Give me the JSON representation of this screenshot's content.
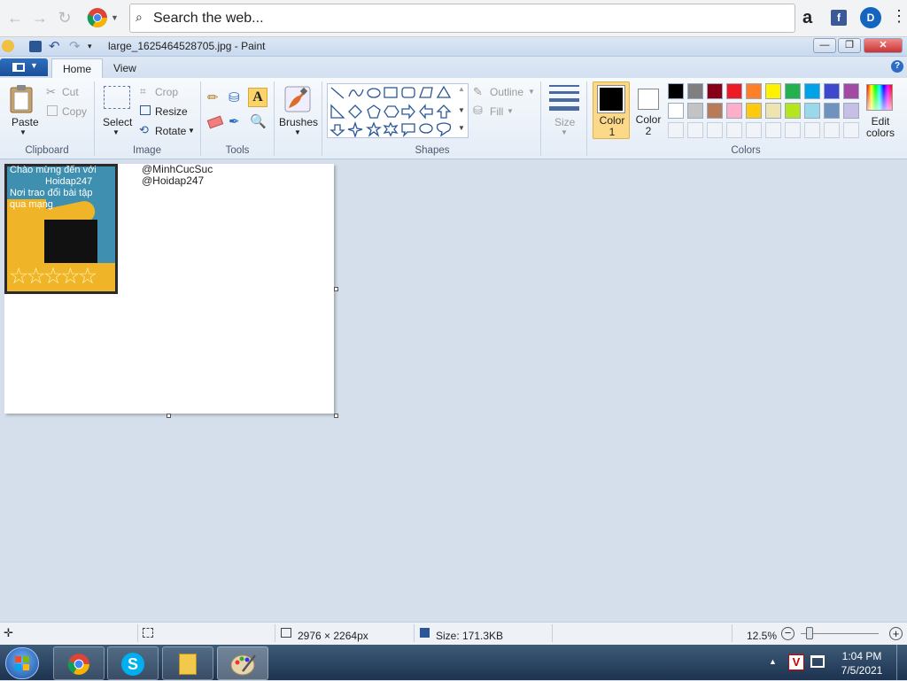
{
  "browser": {
    "search_placeholder": "Search the web...",
    "icons": [
      "back-icon",
      "forward-icon",
      "reload-icon",
      "chrome-icon",
      "search-icon",
      "amazon-icon",
      "facebook-icon",
      "d-icon",
      "more-icon"
    ]
  },
  "paint": {
    "window_title": "large_1625464528705.jpg - Paint",
    "tabs": [
      "Home",
      "View"
    ],
    "clipboard": {
      "paste": "Paste",
      "cut": "Cut",
      "copy": "Copy",
      "label": "Clipboard"
    },
    "image": {
      "select": "Select",
      "crop": "Crop",
      "resize": "Resize",
      "rotate": "Rotate",
      "label": "Image"
    },
    "tools": {
      "label": "Tools"
    },
    "brushes": "Brushes",
    "shapes": {
      "outline": "Outline",
      "fill": "Fill",
      "label": "Shapes"
    },
    "size": "Size",
    "colors": {
      "color1": "Color\n1",
      "color1_line1": "Color",
      "color1_line2": "1",
      "color2_line1": "Color",
      "color2_line2": "2",
      "edit_line1": "Edit",
      "edit_line2": "colors",
      "label": "Colors",
      "row1": [
        "#000000",
        "#7f7f7f",
        "#880015",
        "#ed1c24",
        "#ff7f27",
        "#fff200",
        "#22b14c",
        "#00a2e8",
        "#3f48cc",
        "#a349a4"
      ],
      "row2": [
        "#ffffff",
        "#c3c3c3",
        "#b97a57",
        "#ffaec9",
        "#ffc90e",
        "#efe4b0",
        "#b5e61d",
        "#99d9ea",
        "#7092be",
        "#c8bfe7"
      ]
    }
  },
  "canvas": {
    "thumb_text1": "Chào mừng đến với",
    "thumb_text2": "Hoidap247",
    "thumb_text3": "Nơi trao đổi bài tập",
    "thumb_text4": "qua mạng",
    "handle1": "@MinhCucSuc",
    "handle2": "@Hoidap247"
  },
  "status": {
    "dimensions": "2976 × 2264px",
    "size": "Size: 171.3KB",
    "zoom": "12.5%"
  },
  "taskbar": {
    "time": "1:04 PM",
    "date": "7/5/2021"
  }
}
